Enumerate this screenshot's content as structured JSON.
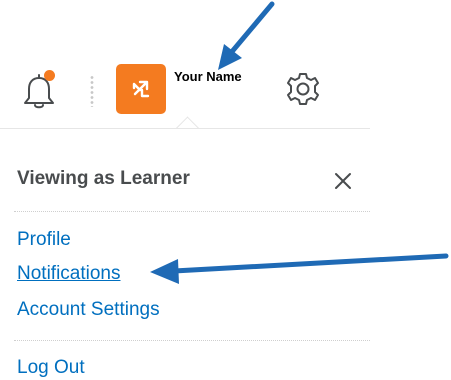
{
  "header": {
    "user_name": "Your Name"
  },
  "dropdown": {
    "title": "Viewing as Learner",
    "menu_items": [
      {
        "label": "Profile"
      },
      {
        "label": "Notifications"
      },
      {
        "label": "Account Settings"
      }
    ],
    "logout_label": "Log Out"
  },
  "colors": {
    "accent_orange": "#f47b20",
    "link_blue": "#006fbf",
    "annotation_arrow_blue": "#1f6ab5",
    "header_text": "#494c4e"
  },
  "icons": {
    "notifications": "bell-icon",
    "avatar": "arrows-swap-icon",
    "settings": "gear-icon",
    "close": "close-icon"
  }
}
